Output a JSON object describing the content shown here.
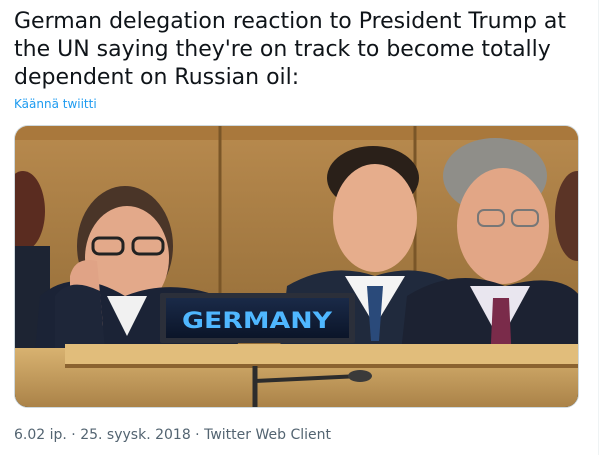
{
  "tweet": {
    "text": "German delegation reaction to President Trump at the UN saying they're on track to become totally dependent on Russian oil:",
    "translate_label": "Käännä twiitti",
    "photo": {
      "nameplate_text": "GERMANY"
    },
    "meta": {
      "time": "6.02 ip.",
      "separator": " · ",
      "date": "25. syysk. 2018",
      "client": "Twitter Web Client"
    }
  },
  "colors": {
    "text": "#0f1419",
    "link": "#1d9bf0",
    "secondary": "#536471",
    "nameplate_text": "#4fb7ff"
  }
}
